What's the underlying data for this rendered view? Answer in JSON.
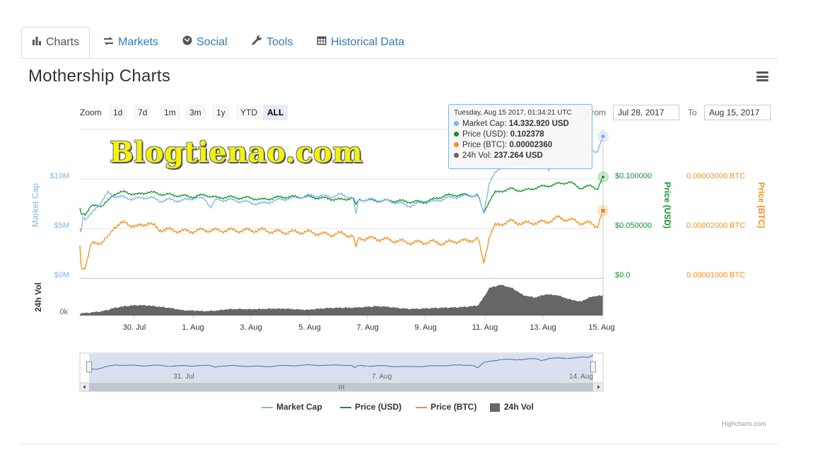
{
  "tabs": [
    {
      "label": "Charts",
      "icon": "bar-chart-icon"
    },
    {
      "label": "Markets",
      "icon": "exchange-icon"
    },
    {
      "label": "Social",
      "icon": "globe-icon"
    },
    {
      "label": "Tools",
      "icon": "wrench-icon"
    },
    {
      "label": "Historical Data",
      "icon": "calendar-icon"
    }
  ],
  "title": "Mothership Charts",
  "watermark": "Blogtienao.com",
  "zoom": {
    "label": "Zoom",
    "buttons": [
      "1d",
      "7d",
      "1m",
      "3m",
      "1y",
      "YTD",
      "ALL"
    ],
    "selected": "ALL"
  },
  "range": {
    "from_label": "From",
    "from": "Jul 28, 2017",
    "to_label": "To",
    "to": "Aug 15, 2017"
  },
  "tooltip": {
    "header": "Tuesday, Aug 15 2017, 01:34:21 UTC",
    "rows": [
      {
        "label": "Market Cap",
        "value": "14.332.920 USD",
        "color": "#7cb5ec"
      },
      {
        "label": "Price (USD)",
        "value": "0.102378",
        "color": "#11922f"
      },
      {
        "label": "Price (BTC)",
        "value": "0.00002360",
        "color": "#f28f1c"
      },
      {
        "label": "24h Vol",
        "value": "237.264 USD",
        "color": "#666666"
      }
    ]
  },
  "credits": "Highcharts.com",
  "chart_data": {
    "type": "line",
    "x_range": [
      "2017-07-28",
      "2017-08-15"
    ],
    "x_ticks": [
      "30. Jul",
      "1. Aug",
      "3. Aug",
      "5. Aug",
      "7. Aug",
      "9. Aug",
      "11. Aug",
      "13. Aug",
      "15. Aug"
    ],
    "navigator_ticks": [
      "31. Jul",
      "7. Aug",
      "14. Aug"
    ],
    "axes": {
      "market_cap": {
        "title": "Market Cap",
        "ticks": [
          "$0M",
          "$5M",
          "$10M"
        ],
        "range": [
          0,
          10000000
        ],
        "color": "#7cb5ec"
      },
      "price_usd": {
        "title": "Price (USD)",
        "ticks": [
          "$0.0",
          "$0.050000",
          "$0.100000"
        ],
        "range": [
          0,
          0.1
        ],
        "color": "#11922f"
      },
      "price_btc": {
        "title": "Price (BTC)",
        "ticks": [
          "0.00001000 BTC",
          "0.00002000 BTC",
          "0.00003000 BTC"
        ],
        "range": [
          1e-05,
          3e-05
        ],
        "color": "#f28f1c"
      },
      "volume": {
        "title": "24h Vol",
        "ticks": [
          "0k"
        ],
        "color": "#666666"
      }
    },
    "series": [
      {
        "name": "Market Cap",
        "unit": "USD",
        "color": "#7cb5ec",
        "points": [
          [
            0,
            5.0
          ],
          [
            0.1,
            4.6
          ],
          [
            0.25,
            6.3
          ],
          [
            0.5,
            6.0
          ],
          [
            1,
            6.4
          ],
          [
            1.5,
            7.2
          ],
          [
            2,
            7.9
          ],
          [
            2.5,
            8.6
          ],
          [
            3,
            8.3
          ],
          [
            4,
            8.1
          ],
          [
            5,
            8.0
          ],
          [
            6,
            8.2
          ],
          [
            7,
            7.8
          ],
          [
            8,
            7.9
          ],
          [
            9,
            7.8
          ],
          [
            10,
            8.1
          ],
          [
            11,
            8.0
          ],
          [
            11.5,
            7.2
          ],
          [
            12,
            7.9
          ],
          [
            13,
            7.9
          ],
          [
            14,
            7.8
          ],
          [
            15,
            7.6
          ],
          [
            16,
            7.5
          ],
          [
            17,
            7.8
          ],
          [
            18,
            8.0
          ],
          [
            19,
            8.1
          ],
          [
            20,
            8.3
          ],
          [
            21,
            8.3
          ],
          [
            22,
            8.2
          ],
          [
            23,
            8.4
          ],
          [
            24,
            8.1
          ],
          [
            24.3,
            6.3
          ],
          [
            24.5,
            8.0
          ],
          [
            25,
            7.9
          ],
          [
            26,
            7.9
          ],
          [
            27,
            7.8
          ],
          [
            28,
            7.6
          ],
          [
            29,
            7.3
          ],
          [
            30,
            7.6
          ],
          [
            31,
            7.7
          ],
          [
            32,
            8.0
          ],
          [
            33,
            8.2
          ],
          [
            34,
            8.3
          ],
          [
            35,
            8.4
          ],
          [
            35.5,
            6.5
          ],
          [
            36,
            9.7
          ],
          [
            36.5,
            10.5
          ],
          [
            37,
            11.2
          ],
          [
            38,
            11.6
          ],
          [
            39,
            11.6
          ],
          [
            40,
            11.9
          ],
          [
            41,
            12.0
          ],
          [
            41.2,
            11.0
          ],
          [
            42,
            12.3
          ],
          [
            43,
            12.4
          ],
          [
            44,
            12.5
          ],
          [
            45,
            12.9
          ],
          [
            45.5,
            12.8
          ],
          [
            46,
            14.3
          ]
        ]
      },
      {
        "name": "Price (USD)",
        "unit": "USD",
        "color": "#11922f",
        "points": [
          [
            0,
            0.071
          ],
          [
            0.1,
            0.065
          ],
          [
            0.25,
            0.066
          ],
          [
            0.5,
            0.065
          ],
          [
            1,
            0.072
          ],
          [
            1.5,
            0.074
          ],
          [
            2,
            0.073
          ],
          [
            2.5,
            0.078
          ],
          [
            3,
            0.085
          ],
          [
            4,
            0.087
          ],
          [
            5,
            0.084
          ],
          [
            6,
            0.087
          ],
          [
            7,
            0.085
          ],
          [
            8,
            0.084
          ],
          [
            9,
            0.083
          ],
          [
            10,
            0.082
          ],
          [
            11,
            0.084
          ],
          [
            12,
            0.081
          ],
          [
            13,
            0.082
          ],
          [
            14,
            0.081
          ],
          [
            15,
            0.081
          ],
          [
            16,
            0.079
          ],
          [
            17,
            0.081
          ],
          [
            18,
            0.082
          ],
          [
            19,
            0.082
          ],
          [
            20,
            0.082
          ],
          [
            21,
            0.081
          ],
          [
            22,
            0.08
          ],
          [
            23,
            0.079
          ],
          [
            24,
            0.081
          ],
          [
            24.3,
            0.073
          ],
          [
            24.5,
            0.079
          ],
          [
            25,
            0.079
          ],
          [
            26,
            0.078
          ],
          [
            27,
            0.078
          ],
          [
            28,
            0.078
          ],
          [
            29,
            0.077
          ],
          [
            30,
            0.077
          ],
          [
            31,
            0.079
          ],
          [
            32,
            0.083
          ],
          [
            33,
            0.084
          ],
          [
            34,
            0.084
          ],
          [
            35,
            0.083
          ],
          [
            35.5,
            0.066
          ],
          [
            36,
            0.078
          ],
          [
            36.5,
            0.086
          ],
          [
            37,
            0.088
          ],
          [
            38,
            0.09
          ],
          [
            39,
            0.088
          ],
          [
            40,
            0.091
          ],
          [
            41,
            0.093
          ],
          [
            42,
            0.095
          ],
          [
            43,
            0.097
          ],
          [
            44,
            0.091
          ],
          [
            45,
            0.093
          ],
          [
            45.5,
            0.09
          ],
          [
            46,
            0.102
          ]
        ]
      },
      {
        "name": "Price (BTC)",
        "unit": "BTC",
        "color": "#f28f1c",
        "points": [
          [
            0,
            1.66e-05
          ],
          [
            0.1,
            1.25e-05
          ],
          [
            0.25,
            1.2e-05
          ],
          [
            0.5,
            1.25e-05
          ],
          [
            1,
            1.68e-05
          ],
          [
            1.5,
            1.72e-05
          ],
          [
            2,
            1.73e-05
          ],
          [
            2.5,
            1.82e-05
          ],
          [
            3,
            2.04e-05
          ],
          [
            4,
            2.12e-05
          ],
          [
            5,
            2.03e-05
          ],
          [
            6,
            2.12e-05
          ],
          [
            7,
            1.98e-05
          ],
          [
            8,
            1.97e-05
          ],
          [
            9,
            1.95e-05
          ],
          [
            10,
            1.95e-05
          ],
          [
            11,
            1.97e-05
          ],
          [
            12,
            1.96e-05
          ],
          [
            13,
            1.97e-05
          ],
          [
            14,
            1.96e-05
          ],
          [
            15,
            1.96e-05
          ],
          [
            16,
            1.97e-05
          ],
          [
            17,
            1.94e-05
          ],
          [
            18,
            1.93e-05
          ],
          [
            19,
            1.93e-05
          ],
          [
            20,
            1.93e-05
          ],
          [
            21,
            1.9e-05
          ],
          [
            22,
            1.88e-05
          ],
          [
            23,
            1.9e-05
          ],
          [
            24,
            1.85e-05
          ],
          [
            24.3,
            1.6e-05
          ],
          [
            24.5,
            1.82e-05
          ],
          [
            25,
            1.8e-05
          ],
          [
            26,
            1.8e-05
          ],
          [
            27,
            1.77e-05
          ],
          [
            28,
            1.75e-05
          ],
          [
            29,
            1.72e-05
          ],
          [
            30,
            1.72e-05
          ],
          [
            31,
            1.73e-05
          ],
          [
            32,
            1.7e-05
          ],
          [
            33,
            1.75e-05
          ],
          [
            34,
            1.75e-05
          ],
          [
            35,
            1.8e-05
          ],
          [
            35.5,
            1.3e-05
          ],
          [
            36,
            1.85e-05
          ],
          [
            36.5,
            2.05e-05
          ],
          [
            37,
            2.1e-05
          ],
          [
            38,
            2.15e-05
          ],
          [
            39,
            2.1e-05
          ],
          [
            40,
            2.12e-05
          ],
          [
            41,
            2.13e-05
          ],
          [
            42,
            2.22e-05
          ],
          [
            43,
            2.18e-05
          ],
          [
            44,
            2.12e-05
          ],
          [
            45,
            2.1e-05
          ],
          [
            45.5,
            2.05e-05
          ],
          [
            46,
            2.36e-05
          ]
        ]
      },
      {
        "name": "24h Vol",
        "unit": "USD",
        "color": "#666666",
        "points": [
          [
            0,
            0.05
          ],
          [
            1,
            0.08
          ],
          [
            2,
            0.12
          ],
          [
            3,
            0.22
          ],
          [
            4,
            0.28
          ],
          [
            5,
            0.31
          ],
          [
            6,
            0.3
          ],
          [
            7,
            0.26
          ],
          [
            8,
            0.22
          ],
          [
            9,
            0.15
          ],
          [
            10,
            0.14
          ],
          [
            11,
            0.12
          ],
          [
            12,
            0.14
          ],
          [
            13,
            0.18
          ],
          [
            14,
            0.19
          ],
          [
            15,
            0.18
          ],
          [
            16,
            0.19
          ],
          [
            17,
            0.2
          ],
          [
            18,
            0.2
          ],
          [
            19,
            0.18
          ],
          [
            20,
            0.16
          ],
          [
            21,
            0.2
          ],
          [
            22,
            0.22
          ],
          [
            23,
            0.23
          ],
          [
            24,
            0.23
          ],
          [
            25,
            0.25
          ],
          [
            26,
            0.28
          ],
          [
            27,
            0.26
          ],
          [
            28,
            0.22
          ],
          [
            29,
            0.19
          ],
          [
            30,
            0.2
          ],
          [
            31,
            0.22
          ],
          [
            32,
            0.23
          ],
          [
            33,
            0.24
          ],
          [
            34,
            0.26
          ],
          [
            35,
            0.3
          ],
          [
            35.5,
            0.55
          ],
          [
            36,
            0.85
          ],
          [
            37,
            0.95
          ],
          [
            38,
            0.85
          ],
          [
            39,
            0.62
          ],
          [
            40,
            0.55
          ],
          [
            41,
            0.65
          ],
          [
            42,
            0.62
          ],
          [
            43,
            0.5
          ],
          [
            44,
            0.42
          ],
          [
            45,
            0.58
          ],
          [
            46,
            0.62
          ]
        ]
      }
    ]
  }
}
